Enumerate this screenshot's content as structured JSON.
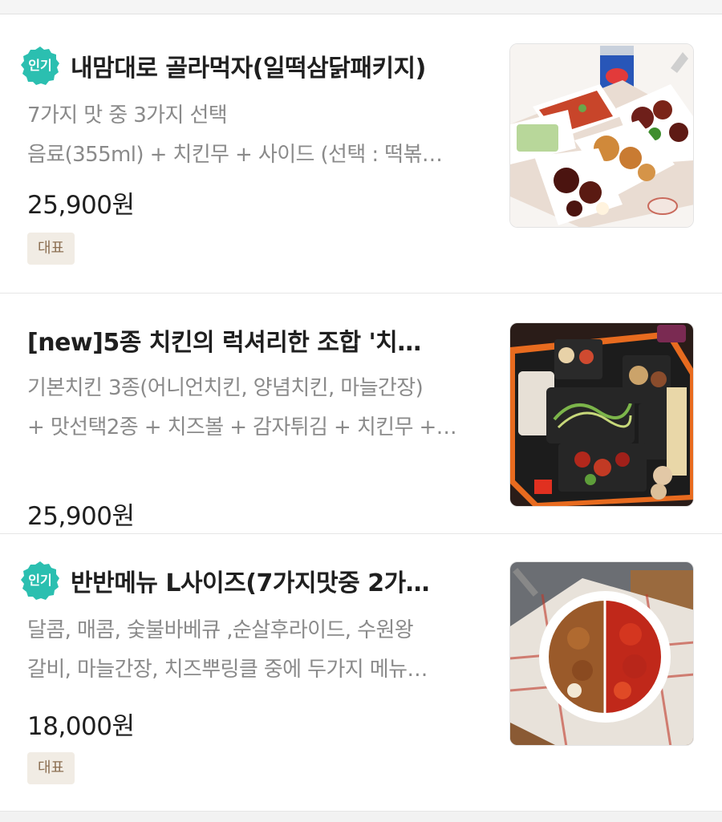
{
  "menu_items": [
    {
      "popular_badge": "인기",
      "title": "내맘대로 골라먹자(일떡삼닭패키지)",
      "description_lines": [
        "7가지 맛 중 3가지 선택",
        "음료(355ml) + 치킨무 + 사이드 (선택 : 떡볶…"
      ],
      "price": "25,900원",
      "tag": "대표"
    },
    {
      "popular_badge": "",
      "title": "[new]5종 치킨의 럭셔리한 조합 '치…",
      "description_lines": [
        "기본치킨 3종(어니언치킨, 양념치킨, 마늘간장)",
        "+ 맛선택2종 + 치즈볼 + 감자튀김 + 치킨무 +…"
      ],
      "price": "25,900원",
      "tag": ""
    },
    {
      "popular_badge": "인기",
      "title": "반반메뉴 L사이즈(7가지맛중 2가…",
      "description_lines": [
        "달콤, 매콤, 숯불바베큐 ,순살후라이드, 수원왕",
        "갈비, 마늘간장, 치즈뿌링클 중에 두가지 메뉴…"
      ],
      "price": "18,000원",
      "tag": "대표"
    }
  ],
  "colors": {
    "badge": "#2bbfb0",
    "tag_bg": "#f1ece4",
    "tag_text": "#8c6f52"
  }
}
